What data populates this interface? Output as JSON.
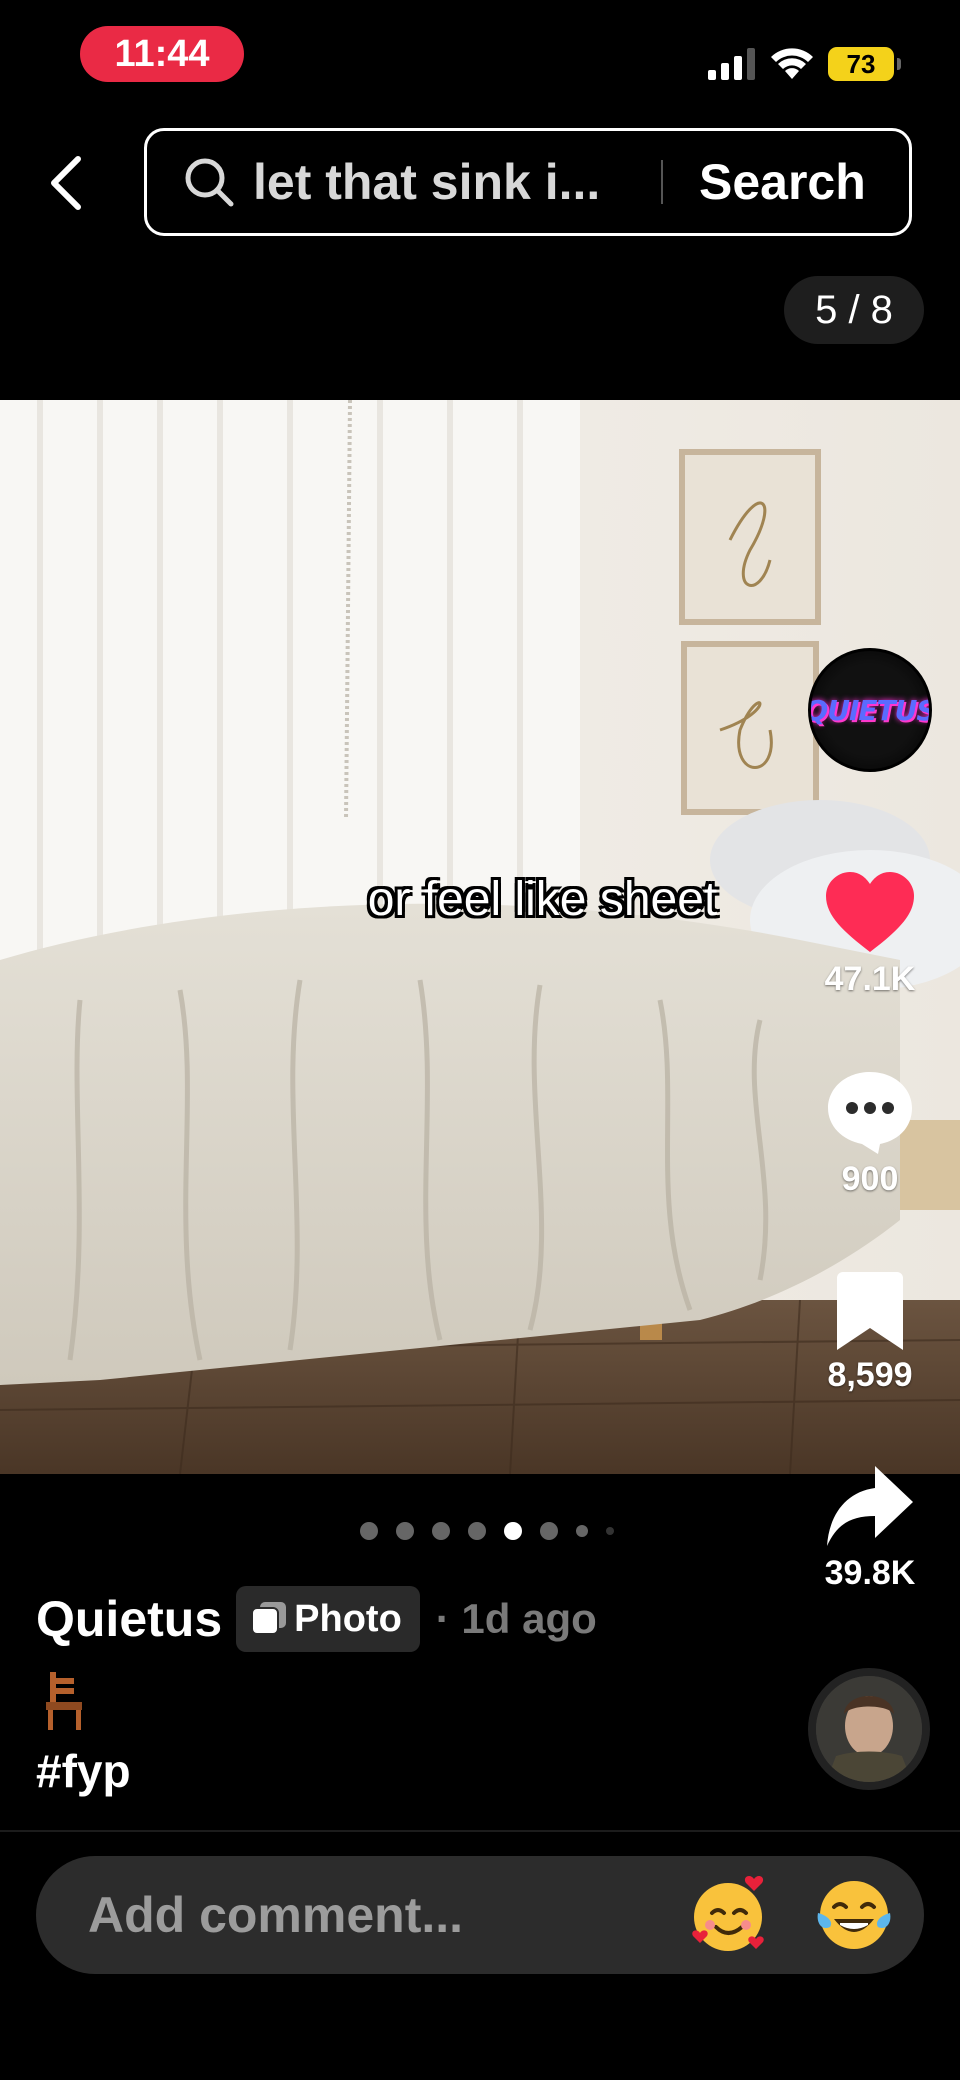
{
  "status_bar": {
    "time": "11:44",
    "battery": "73"
  },
  "search": {
    "query": "let that sink i...",
    "button_label": "Search"
  },
  "page_counter": "5 / 8",
  "photo": {
    "caption": "or feel like sheet"
  },
  "creator": {
    "logo_text": "QUIETUS"
  },
  "actions": {
    "likes": "47.1K",
    "comments": "900",
    "bookmarks": "8,599",
    "shares": "39.8K"
  },
  "pagination": {
    "total": 8,
    "active_index": 4
  },
  "post": {
    "author": "Quietus",
    "badge_label": "Photo",
    "time_ago": "· 1d ago",
    "hashtag": "#fyp"
  },
  "comment_bar": {
    "placeholder": "Add comment..."
  },
  "colors": {
    "accent_red": "#ea2a45",
    "heart": "#fe2c55",
    "battery": "#f4d21a"
  },
  "icons": [
    "back-chevron-icon",
    "search-icon",
    "heart-icon",
    "comment-icon",
    "bookmark-icon",
    "share-icon",
    "photo-icon",
    "chair-emoji-icon",
    "smiling-hearts-emoji-icon",
    "laughing-tears-emoji-icon"
  ]
}
